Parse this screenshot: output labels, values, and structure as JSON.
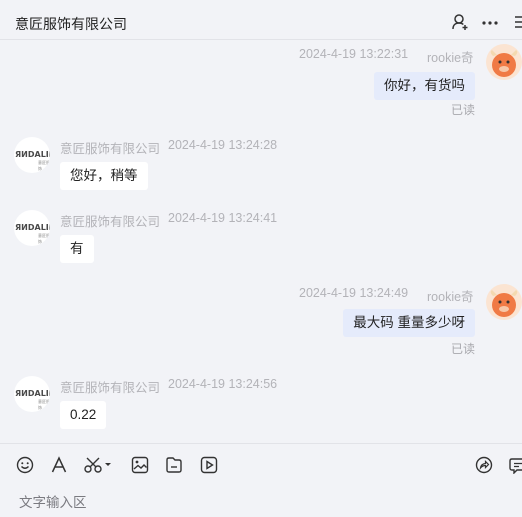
{
  "header": {
    "title": "意匠服饰有限公司",
    "icons": [
      "add-user-icon",
      "more-icon",
      "list-icon"
    ]
  },
  "shop": {
    "logo_text": "ЯИDALII",
    "logo_sub": "意匠服饰"
  },
  "messages": [
    {
      "side": "out",
      "sender": "rookie奇",
      "time": "2024-4-19 13:22:31",
      "text": "你好，有货吗",
      "status": "已读"
    },
    {
      "side": "in",
      "sender": "意匠服饰有限公司",
      "time": "2024-4-19 13:24:28",
      "text": "您好，稍等"
    },
    {
      "side": "in",
      "sender": "意匠服饰有限公司",
      "time": "2024-4-19 13:24:41",
      "text": "有"
    },
    {
      "side": "out",
      "sender": "rookie奇",
      "time": "2024-4-19 13:24:49",
      "text": "最大码  重量多少呀",
      "status": "已读"
    },
    {
      "side": "in",
      "sender": "意匠服饰有限公司",
      "time": "2024-4-19 13:24:56",
      "text": "0.22"
    }
  ],
  "toolbar": {
    "icons": [
      "emoji-icon",
      "font-icon",
      "scissors-icon",
      "image-icon",
      "file-icon",
      "video-icon",
      "share-icon",
      "quick-reply-icon"
    ],
    "placeholder": "文字输入区"
  },
  "colors": {
    "background": "#f2f3f7",
    "out_bubble": "#e5ebfb",
    "in_bubble": "#ffffff",
    "meta_text": "#b3b3b8"
  }
}
